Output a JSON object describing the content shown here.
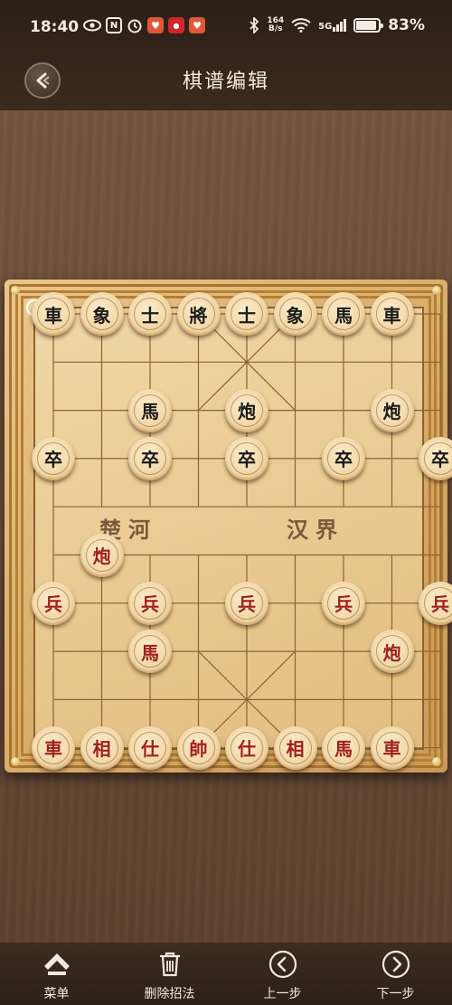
{
  "status_bar": {
    "time": "18:40",
    "speed_value": "164",
    "speed_unit": "B/s",
    "network": "5G",
    "battery_pct": "83%",
    "battery_level": 0.83
  },
  "header": {
    "title": "棋谱编辑",
    "back_icon": "back-chevron-icon"
  },
  "board": {
    "river_left": "楚河",
    "river_right": "汉界",
    "files": 9,
    "ranks": 10,
    "pieces": [
      {
        "label": "車",
        "side": "black",
        "file": 0,
        "rank": 0
      },
      {
        "label": "象",
        "side": "black",
        "file": 1,
        "rank": 0
      },
      {
        "label": "士",
        "side": "black",
        "file": 2,
        "rank": 0
      },
      {
        "label": "將",
        "side": "black",
        "file": 3,
        "rank": 0
      },
      {
        "label": "士",
        "side": "black",
        "file": 4,
        "rank": 0
      },
      {
        "label": "象",
        "side": "black",
        "file": 5,
        "rank": 0
      },
      {
        "label": "馬",
        "side": "black",
        "file": 6,
        "rank": 0
      },
      {
        "label": "車",
        "side": "black",
        "file": 7,
        "rank": 0
      },
      {
        "label": "馬",
        "side": "black",
        "file": 2,
        "rank": 2
      },
      {
        "label": "炮",
        "side": "black",
        "file": 4,
        "rank": 2
      },
      {
        "label": "炮",
        "side": "black",
        "file": 7,
        "rank": 2
      },
      {
        "label": "卒",
        "side": "black",
        "file": 0,
        "rank": 3
      },
      {
        "label": "卒",
        "side": "black",
        "file": 2,
        "rank": 3
      },
      {
        "label": "卒",
        "side": "black",
        "file": 4,
        "rank": 3
      },
      {
        "label": "卒",
        "side": "black",
        "file": 6,
        "rank": 3
      },
      {
        "label": "卒",
        "side": "black",
        "file": 8,
        "rank": 3
      },
      {
        "label": "炮",
        "side": "red",
        "file": 1,
        "rank": 5
      },
      {
        "label": "兵",
        "side": "red",
        "file": 0,
        "rank": 6
      },
      {
        "label": "兵",
        "side": "red",
        "file": 2,
        "rank": 6
      },
      {
        "label": "兵",
        "side": "red",
        "file": 4,
        "rank": 6
      },
      {
        "label": "兵",
        "side": "red",
        "file": 6,
        "rank": 6
      },
      {
        "label": "兵",
        "side": "red",
        "file": 8,
        "rank": 6
      },
      {
        "label": "馬",
        "side": "red",
        "file": 2,
        "rank": 7
      },
      {
        "label": "炮",
        "side": "red",
        "file": 7,
        "rank": 7
      },
      {
        "label": "車",
        "side": "red",
        "file": 0,
        "rank": 9
      },
      {
        "label": "相",
        "side": "red",
        "file": 1,
        "rank": 9
      },
      {
        "label": "仕",
        "side": "red",
        "file": 2,
        "rank": 9
      },
      {
        "label": "帥",
        "side": "red",
        "file": 3,
        "rank": 9
      },
      {
        "label": "仕",
        "side": "red",
        "file": 4,
        "rank": 9
      },
      {
        "label": "相",
        "side": "red",
        "file": 5,
        "rank": 9
      },
      {
        "label": "馬",
        "side": "red",
        "file": 6,
        "rank": 9
      },
      {
        "label": "車",
        "side": "red",
        "file": 7,
        "rank": 9
      }
    ]
  },
  "bottom_nav": {
    "items": [
      {
        "label": "菜单",
        "icon": "menu-icon"
      },
      {
        "label": "删除招法",
        "icon": "trash-icon"
      },
      {
        "label": "上一步",
        "icon": "prev-icon"
      },
      {
        "label": "下一步",
        "icon": "next-icon"
      }
    ]
  },
  "colors": {
    "black_piece_text": "#1d1a18",
    "red_piece_text": "#a0201a",
    "board_line": "#8d6330"
  }
}
